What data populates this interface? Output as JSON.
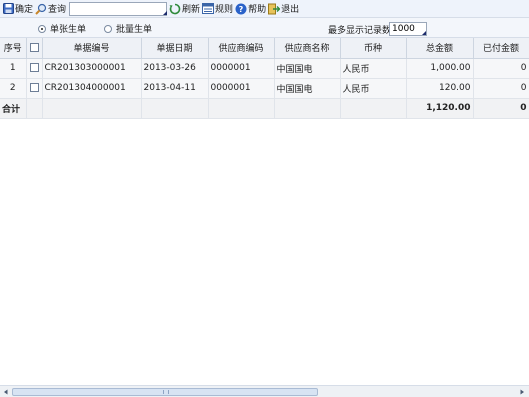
{
  "toolbar": {
    "confirm_label": "确定",
    "query_label": "查询",
    "search_value": "",
    "refresh_label": "刷新",
    "rules_label": "规则",
    "help_label": "帮助",
    "exit_label": "退出"
  },
  "options": {
    "single_label": "单张生单",
    "batch_label": "批量生单",
    "max_records_label": "最多显示记录数",
    "max_records_required_mark": "*",
    "max_records_value": "1000"
  },
  "table": {
    "headers": [
      "序号",
      "",
      "单据编号",
      "单据日期",
      "供应商编码",
      "供应商名称",
      "币种",
      "总金额",
      "已付金额"
    ],
    "rows": [
      {
        "seq": "1",
        "doc_no": "CR201303000001",
        "date": "2013-03-26",
        "supplier_code": "0000001",
        "supplier_name": "中国国电",
        "currency": "人民币",
        "total": "1,000.00",
        "paid": "0"
      },
      {
        "seq": "2",
        "doc_no": "CR201304000001",
        "date": "2013-04-11",
        "supplier_code": "0000001",
        "supplier_name": "中国国电",
        "currency": "人民币",
        "total": "120.00",
        "paid": "0"
      }
    ],
    "total_row": {
      "label": "合计",
      "total": "1,120.00",
      "paid": "0"
    }
  },
  "colors": {
    "toolbar_bg": "#eef3fb",
    "header_bg": "#eef1f6",
    "row_bg": "#f6f7f9"
  }
}
